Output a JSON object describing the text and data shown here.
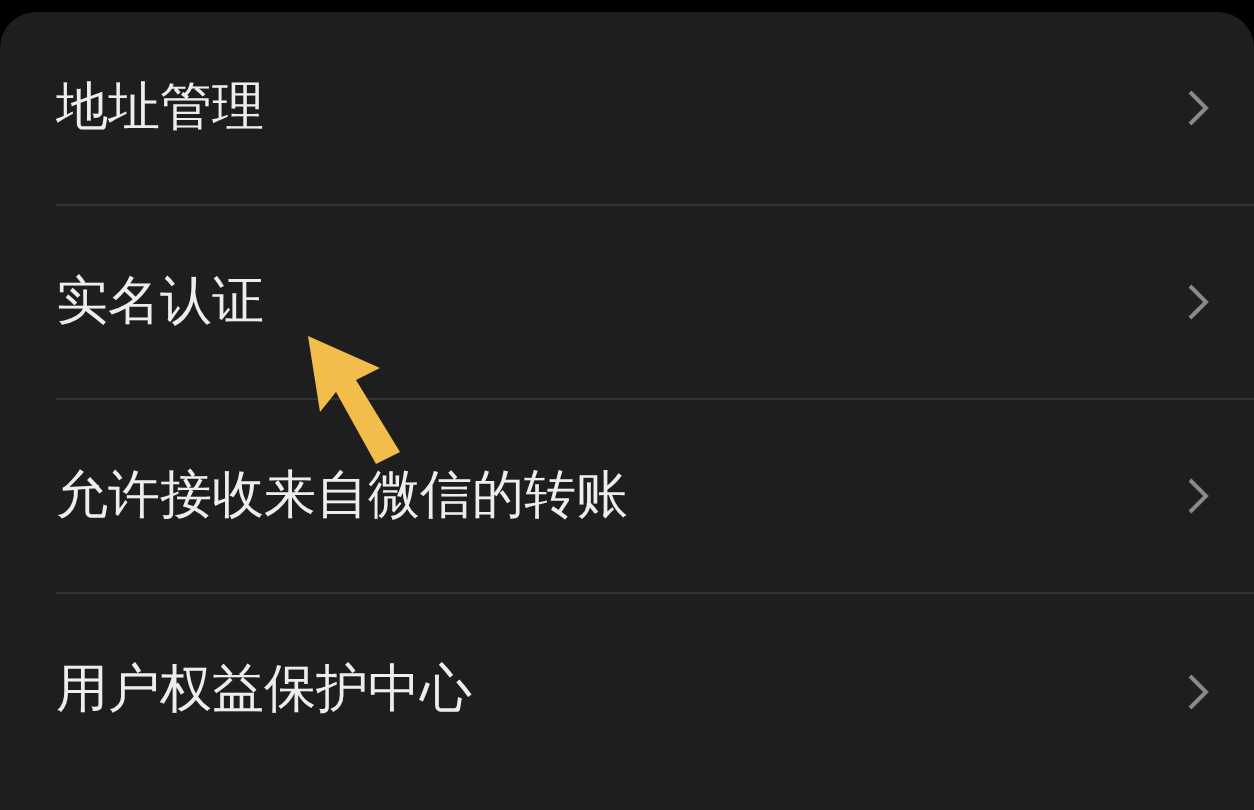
{
  "menu": {
    "items": [
      {
        "label": "地址管理"
      },
      {
        "label": "实名认证"
      },
      {
        "label": "允许接收来自微信的转账"
      },
      {
        "label": "用户权益保护中心"
      }
    ]
  }
}
